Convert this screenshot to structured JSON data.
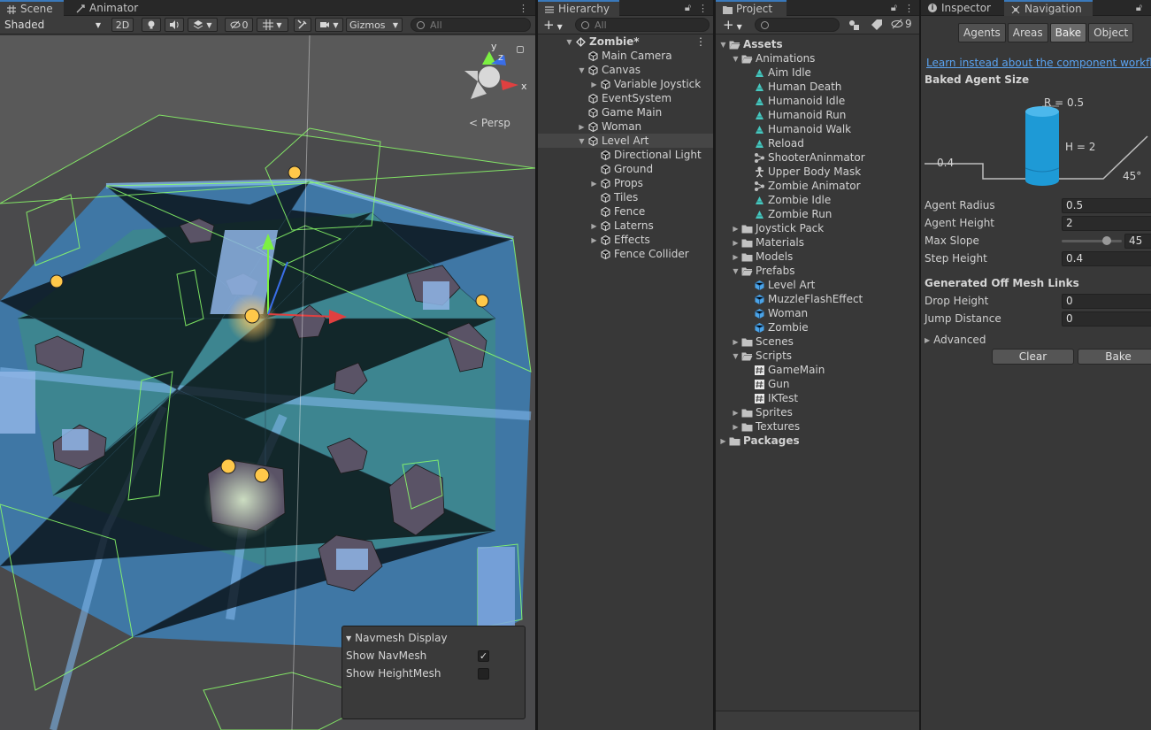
{
  "scene_panel": {
    "tabs": {
      "scene": "Scene",
      "animator": "Animator"
    },
    "toolbar": {
      "shading": "Shaded",
      "mode_2d": "2D",
      "hidden_count": "0",
      "gizmos": "Gizmos",
      "search_placeholder": "All"
    },
    "view_label": "Persp",
    "gizmo_axes": {
      "y": "y",
      "z": "z",
      "x": "x"
    },
    "navmesh_display": {
      "title": "Navmesh Display",
      "show_navmesh": {
        "label": "Show NavMesh",
        "checked": true
      },
      "show_heightmesh": {
        "label": "Show HeightMesh",
        "checked": false
      }
    }
  },
  "hierarchy": {
    "tab": "Hierarchy",
    "search_placeholder": "All",
    "items": [
      {
        "label": "Zombie*",
        "depth": 0,
        "expanded": true,
        "kind": "scene"
      },
      {
        "label": "Main Camera",
        "depth": 1,
        "kind": "go"
      },
      {
        "label": "Canvas",
        "depth": 1,
        "expanded": true,
        "kind": "go"
      },
      {
        "label": "Variable Joystick",
        "depth": 2,
        "expanded": false,
        "kind": "go"
      },
      {
        "label": "EventSystem",
        "depth": 1,
        "kind": "go"
      },
      {
        "label": "Game Main",
        "depth": 1,
        "kind": "go"
      },
      {
        "label": "Woman",
        "depth": 1,
        "expanded": false,
        "kind": "go"
      },
      {
        "label": "Level Art",
        "depth": 1,
        "expanded": true,
        "kind": "go",
        "selected": true
      },
      {
        "label": "Directional Light",
        "depth": 2,
        "kind": "go"
      },
      {
        "label": "Ground",
        "depth": 2,
        "kind": "go"
      },
      {
        "label": "Props",
        "depth": 2,
        "expanded": false,
        "kind": "go"
      },
      {
        "label": "Tiles",
        "depth": 2,
        "kind": "go"
      },
      {
        "label": "Fence",
        "depth": 2,
        "kind": "go"
      },
      {
        "label": "Laterns",
        "depth": 2,
        "expanded": false,
        "kind": "go"
      },
      {
        "label": "Effects",
        "depth": 2,
        "expanded": false,
        "kind": "go"
      },
      {
        "label": "Fence Collider",
        "depth": 2,
        "kind": "go"
      }
    ]
  },
  "project": {
    "tab": "Project",
    "hidden_count": "9",
    "items": [
      {
        "label": "Assets",
        "depth": 0,
        "expanded": true,
        "kind": "folder-open",
        "bold": true
      },
      {
        "label": "Animations",
        "depth": 1,
        "expanded": true,
        "kind": "folder-open"
      },
      {
        "label": "Aim Idle",
        "depth": 2,
        "kind": "anim"
      },
      {
        "label": "Human Death",
        "depth": 2,
        "kind": "anim"
      },
      {
        "label": "Humanoid Idle",
        "depth": 2,
        "kind": "anim"
      },
      {
        "label": "Humanoid Run",
        "depth": 2,
        "kind": "anim"
      },
      {
        "label": "Humanoid Walk",
        "depth": 2,
        "kind": "anim"
      },
      {
        "label": "Reload",
        "depth": 2,
        "kind": "anim"
      },
      {
        "label": "ShooterAninmator",
        "depth": 2,
        "kind": "controller"
      },
      {
        "label": "Upper Body Mask",
        "depth": 2,
        "kind": "mask"
      },
      {
        "label": "Zombie Animator",
        "depth": 2,
        "kind": "controller"
      },
      {
        "label": "Zombie Idle",
        "depth": 2,
        "kind": "anim"
      },
      {
        "label": "Zombie Run",
        "depth": 2,
        "kind": "anim"
      },
      {
        "label": "Joystick Pack",
        "depth": 1,
        "expanded": false,
        "kind": "folder"
      },
      {
        "label": "Materials",
        "depth": 1,
        "expanded": false,
        "kind": "folder"
      },
      {
        "label": "Models",
        "depth": 1,
        "expanded": false,
        "kind": "folder"
      },
      {
        "label": "Prefabs",
        "depth": 1,
        "expanded": true,
        "kind": "folder-open"
      },
      {
        "label": "Level Art",
        "depth": 2,
        "kind": "prefab"
      },
      {
        "label": "MuzzleFlashEffect",
        "depth": 2,
        "kind": "prefab"
      },
      {
        "label": "Woman",
        "depth": 2,
        "kind": "prefab"
      },
      {
        "label": "Zombie",
        "depth": 2,
        "kind": "prefab"
      },
      {
        "label": "Scenes",
        "depth": 1,
        "expanded": false,
        "kind": "folder"
      },
      {
        "label": "Scripts",
        "depth": 1,
        "expanded": true,
        "kind": "folder-open"
      },
      {
        "label": "GameMain",
        "depth": 2,
        "kind": "script"
      },
      {
        "label": "Gun",
        "depth": 2,
        "kind": "script"
      },
      {
        "label": "IKTest",
        "depth": 2,
        "kind": "script"
      },
      {
        "label": "Sprites",
        "depth": 1,
        "expanded": false,
        "kind": "folder"
      },
      {
        "label": "Textures",
        "depth": 1,
        "expanded": false,
        "kind": "folder"
      },
      {
        "label": "Packages",
        "depth": 0,
        "expanded": false,
        "kind": "folder",
        "bold": true
      }
    ]
  },
  "navigation": {
    "tabs": {
      "inspector": "Inspector",
      "navigation": "Navigation"
    },
    "segments": [
      "Agents",
      "Areas",
      "Bake",
      "Object"
    ],
    "active_segment": "Bake",
    "link": "Learn instead about the component workflow",
    "baked_agent_size": {
      "title": "Baked Agent Size",
      "radius_label": "R = 0.5",
      "height_label": "H = 2",
      "step_label": "0.4",
      "slope_label": "45°"
    },
    "fields": {
      "agent_radius": {
        "label": "Agent Radius",
        "value": "0.5"
      },
      "agent_height": {
        "label": "Agent Height",
        "value": "2"
      },
      "max_slope": {
        "label": "Max Slope",
        "value": "45",
        "fraction": 0.75
      },
      "step_height": {
        "label": "Step Height",
        "value": "0.4"
      }
    },
    "off_mesh": {
      "title": "Generated Off Mesh Links",
      "drop_height": {
        "label": "Drop Height",
        "value": "0"
      },
      "jump_distance": {
        "label": "Jump Distance",
        "value": "0"
      }
    },
    "advanced": "Advanced",
    "buttons": {
      "clear": "Clear",
      "bake": "Bake"
    }
  },
  "colors": {
    "accent": "#3a79bb",
    "link": "#5aa3f2",
    "navmesh": "#3f86c6",
    "navmesh_walkable_green": "#3aa06a",
    "collider_green": "#8cff6a",
    "agent_cylinder": "#1e9ad6",
    "panel_bg": "#383838",
    "viewport_bg": "#5b5b5b"
  }
}
